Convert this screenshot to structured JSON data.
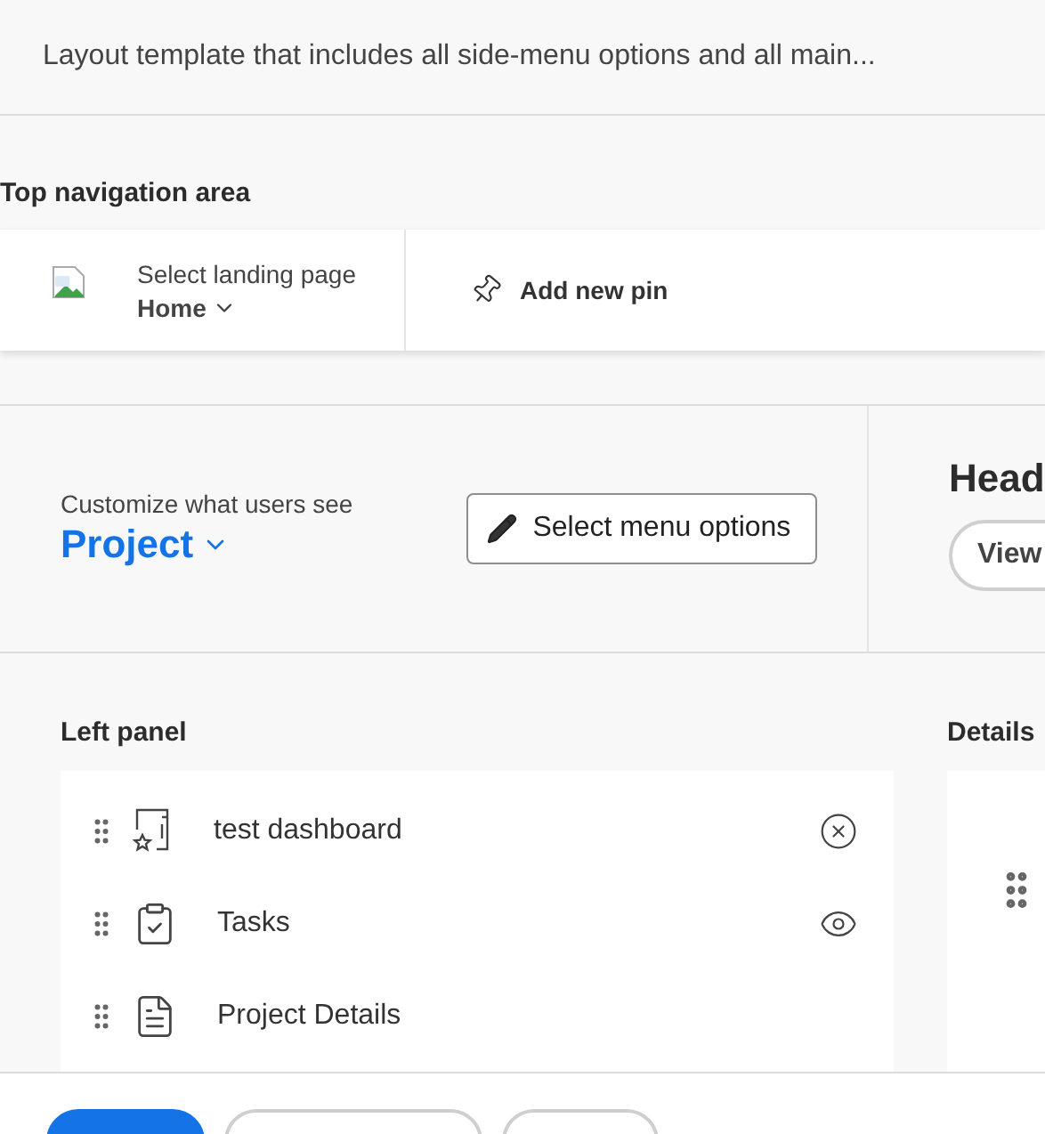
{
  "header": {
    "description": "Layout template that includes all side-menu options and all main..."
  },
  "top_navigation": {
    "title": "Top navigation area",
    "landing_label": "Select landing page",
    "landing_value": "Home",
    "pin_button": "Add new pin"
  },
  "customize": {
    "label": "Customize what users see",
    "object": "Project",
    "menu_button": "Select menu options"
  },
  "right_header": {
    "title": "Head",
    "button": "View"
  },
  "left_panel": {
    "title": "Left panel",
    "items": [
      {
        "label": "test dashboard",
        "kind": "dashboard",
        "action": {
          "kind": "remove"
        }
      },
      {
        "label": "Tasks",
        "kind": "tasks",
        "action": {
          "kind": "show"
        }
      },
      {
        "label": "Project Details",
        "kind": "details"
      }
    ]
  },
  "details_panel": {
    "title": "Details"
  },
  "footer": {
    "buttons": [
      {
        "kind": "primary"
      },
      {
        "kind": "secondary"
      },
      {
        "kind": "secondary"
      }
    ]
  }
}
